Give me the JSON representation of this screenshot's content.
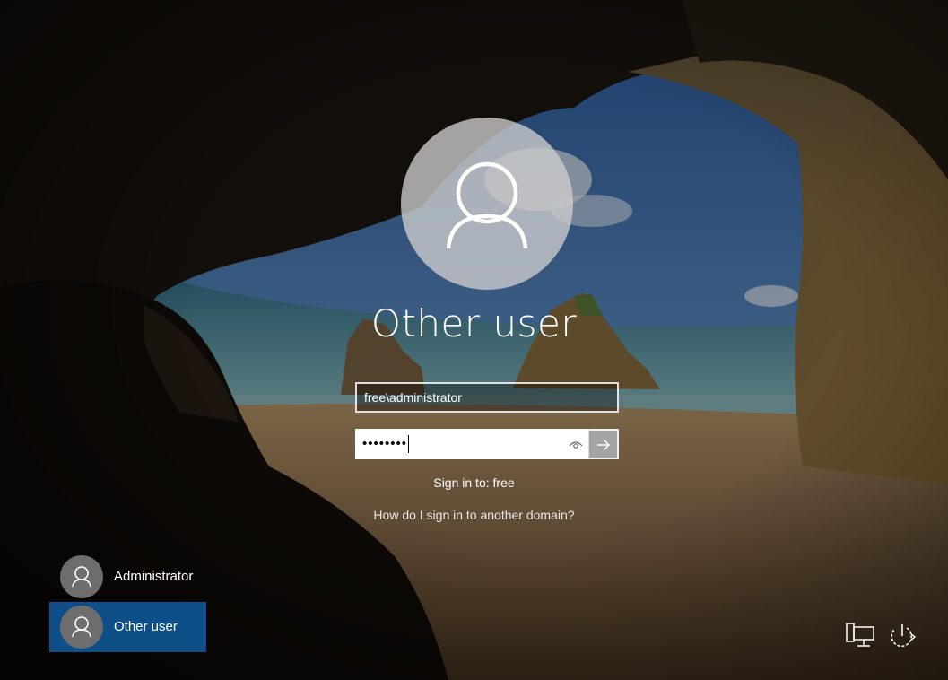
{
  "login": {
    "user_title": "Other user",
    "username_value": "free\\administrator",
    "password_masked": "••••••••",
    "sign_in_to": "Sign in to: free",
    "other_domain_link": "How do I sign in to another domain?"
  },
  "users": [
    {
      "label": "Administrator",
      "selected": false
    },
    {
      "label": "Other user",
      "selected": true
    }
  ],
  "icons": {
    "network": "network-icon",
    "power": "power-icon",
    "reveal": "eye-icon",
    "submit": "arrow-right-icon",
    "avatar": "user-icon"
  },
  "colors": {
    "selected_tile": "#0e4f8a"
  }
}
